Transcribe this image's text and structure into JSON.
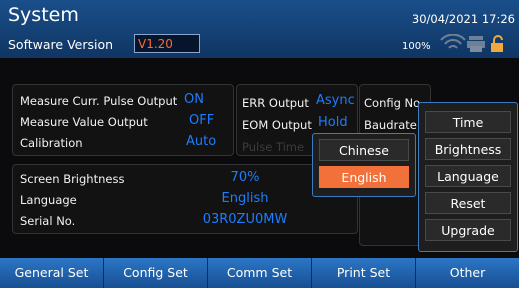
{
  "header": {
    "title": "System",
    "software_version_label": "Software Version",
    "software_version_value": "V1.20",
    "date": "30/04/2021 17:26",
    "battery": "100%"
  },
  "colors": {
    "accent_blue": "#1d7dff",
    "selected_orange": "#f2703a",
    "header_blue": "#1a4f8a"
  },
  "panel1": {
    "rows": [
      {
        "label": "Measure Curr. Pulse Output",
        "value": "ON"
      },
      {
        "label": "Measure Value Output",
        "value": "OFF"
      },
      {
        "label": "Calibration",
        "value": "Auto"
      }
    ]
  },
  "panel2": {
    "rows": [
      {
        "label": "ERR Output",
        "value": "Async"
      },
      {
        "label": "EOM Output",
        "value": "Hold"
      },
      {
        "label": "Pulse Time",
        "value": ""
      }
    ]
  },
  "panel3": {
    "rows": [
      {
        "label": "Config No."
      },
      {
        "label": "Baudrate"
      }
    ]
  },
  "panel4": {
    "rows": [
      {
        "label": "Screen Brightness",
        "value": "70%"
      },
      {
        "label": "Language",
        "value": "English"
      },
      {
        "label": "Serial No.",
        "value": "03R0ZU0MW"
      }
    ]
  },
  "language_popup": {
    "options": [
      "Chinese",
      "English"
    ],
    "selected": "English"
  },
  "other_menu": {
    "items": [
      "Time",
      "Brightness",
      "Language",
      "Reset",
      "Upgrade"
    ]
  },
  "tabs": [
    "General Set",
    "Config Set",
    "Comm Set",
    "Print Set",
    "Other"
  ],
  "icons": [
    "wifi-icon",
    "printer-icon",
    "lock-icon"
  ]
}
